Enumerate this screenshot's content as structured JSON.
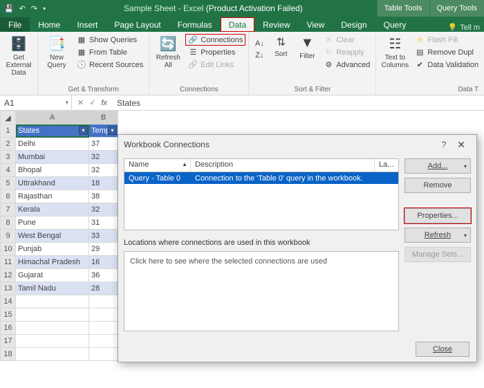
{
  "title": {
    "app": "Sample Sheet - Excel",
    "status": "(Product Activation Failed)"
  },
  "tooltabs": [
    "Table Tools",
    "Query Tools"
  ],
  "tabs": {
    "file": "File",
    "home": "Home",
    "insert": "Insert",
    "pagelayout": "Page Layout",
    "formulas": "Formulas",
    "data": "Data",
    "review": "Review",
    "view": "View",
    "design": "Design",
    "query": "Query",
    "tell": "Tell m"
  },
  "ribbon": {
    "getexternal": "Get External\nData",
    "newquery": "New\nQuery",
    "showqueries": "Show Queries",
    "fromtable": "From Table",
    "recentsources": "Recent Sources",
    "gettransform": "Get & Transform",
    "refreshall": "Refresh\nAll",
    "connections": "Connections",
    "properties": "Properties",
    "editlinks": "Edit Links",
    "conn_group": "Connections",
    "sort": "Sort",
    "filter": "Filter",
    "clear": "Clear",
    "reapply": "Reapply",
    "advanced": "Advanced",
    "sortfilter": "Sort & Filter",
    "texttocols": "Text to\nColumns",
    "flashfill": "Flash Fill",
    "removedup": "Remove Dupl",
    "datavalid": "Data Validation",
    "datatools": "Data T"
  },
  "fbar": {
    "name": "A1",
    "fx": "fx",
    "value": "States"
  },
  "grid": {
    "cols": [
      "A",
      "B"
    ],
    "headers": {
      "a": "States",
      "b": "Temp"
    },
    "rows": [
      {
        "n": 1,
        "a": "States",
        "b": "Temp",
        "hdr": true
      },
      {
        "n": 2,
        "a": "Delhi",
        "b": "37"
      },
      {
        "n": 3,
        "a": "Mumbai",
        "b": "32"
      },
      {
        "n": 4,
        "a": "Bhopal",
        "b": "32"
      },
      {
        "n": 5,
        "a": "Uttrakhand",
        "b": "18"
      },
      {
        "n": 6,
        "a": "Rajasthan",
        "b": "38"
      },
      {
        "n": 7,
        "a": "Kerala",
        "b": "32"
      },
      {
        "n": 8,
        "a": "Pune",
        "b": "31"
      },
      {
        "n": 9,
        "a": "West Bengal",
        "b": "33"
      },
      {
        "n": 10,
        "a": "Punjab",
        "b": "29"
      },
      {
        "n": 11,
        "a": "Himachal Pradesh",
        "b": "16"
      },
      {
        "n": 12,
        "a": "Gujarat",
        "b": "36"
      },
      {
        "n": 13,
        "a": "Tamil Nadu",
        "b": "28"
      },
      {
        "n": 14,
        "a": "",
        "b": ""
      },
      {
        "n": 15,
        "a": "",
        "b": ""
      },
      {
        "n": 16,
        "a": "",
        "b": ""
      },
      {
        "n": 17,
        "a": "",
        "b": ""
      },
      {
        "n": 18,
        "a": "",
        "b": ""
      }
    ]
  },
  "dialog": {
    "title": "Workbook Connections",
    "cols": {
      "name": "Name",
      "desc": "Description",
      "last": "La..."
    },
    "row": {
      "name": "Query - Table 0",
      "desc": "Connection to the 'Table 0' query in the workbook."
    },
    "loc_label": "Locations where connections are used in this workbook",
    "loc_hint": "Click here to see where the selected connections are used",
    "btns": {
      "add": "Add...",
      "remove": "Remove",
      "props": "Properties...",
      "refresh": "Refresh",
      "manage": "Manage Sets...",
      "close": "Close"
    }
  }
}
